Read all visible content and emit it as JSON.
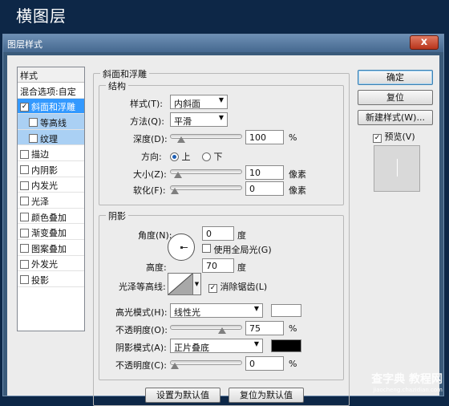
{
  "page_heading": "横图层",
  "window": {
    "title": "图层样式",
    "close_glyph": "x"
  },
  "styles_panel": {
    "header": "样式",
    "blend_options": "混合选项:自定",
    "items": [
      {
        "label": "斜面和浮雕",
        "checked": true,
        "selected": true,
        "sub": false
      },
      {
        "label": "等高线",
        "checked": false,
        "selected": false,
        "sub": true
      },
      {
        "label": "纹理",
        "checked": false,
        "selected": false,
        "sub": true
      },
      {
        "label": "描边",
        "checked": false,
        "selected": false,
        "sub": false
      },
      {
        "label": "内阴影",
        "checked": false,
        "selected": false,
        "sub": false
      },
      {
        "label": "内发光",
        "checked": false,
        "selected": false,
        "sub": false
      },
      {
        "label": "光泽",
        "checked": false,
        "selected": false,
        "sub": false
      },
      {
        "label": "颜色叠加",
        "checked": false,
        "selected": false,
        "sub": false
      },
      {
        "label": "渐变叠加",
        "checked": false,
        "selected": false,
        "sub": false
      },
      {
        "label": "图案叠加",
        "checked": false,
        "selected": false,
        "sub": false
      },
      {
        "label": "外发光",
        "checked": false,
        "selected": false,
        "sub": false
      },
      {
        "label": "投影",
        "checked": false,
        "selected": false,
        "sub": false
      }
    ]
  },
  "bevel": {
    "group_title": "斜面和浮雕",
    "structure": {
      "title": "结构",
      "style_label": "样式(T):",
      "style_value": "内斜面",
      "technique_label": "方法(Q):",
      "technique_value": "平滑",
      "depth_label": "深度(D):",
      "depth_value": "100",
      "depth_unit": "%",
      "depth_fraction": 0.1,
      "direction_label": "方向:",
      "direction_up": "上",
      "direction_down": "下",
      "direction_selected": "上",
      "size_label": "大小(Z):",
      "size_value": "10",
      "size_unit": "像素",
      "size_fraction": 0.05,
      "soften_label": "软化(F):",
      "soften_value": "0",
      "soften_unit": "像素",
      "soften_fraction": 0.0
    },
    "shading": {
      "title": "阴影",
      "angle_label": "角度(N):",
      "angle_value": "0",
      "angle_unit": "度",
      "global_light_label": "使用全局光(G)",
      "global_light_checked": false,
      "altitude_label": "高度:",
      "altitude_value": "70",
      "altitude_unit": "度",
      "gloss_contour_label": "光泽等高线:",
      "anti_alias_label": "消除锯齿(L)",
      "anti_alias_checked": true,
      "highlight_mode_label": "高光模式(H):",
      "highlight_mode_value": "线性光",
      "highlight_color": "#ffffff",
      "highlight_opacity_label": "不透明度(O):",
      "highlight_opacity_value": "75",
      "highlight_opacity_unit": "%",
      "highlight_opacity_fraction": 0.75,
      "shadow_mode_label": "阴影模式(A):",
      "shadow_mode_value": "正片叠底",
      "shadow_color": "#000000",
      "shadow_opacity_label": "不透明度(C):",
      "shadow_opacity_value": "0",
      "shadow_opacity_unit": "%",
      "shadow_opacity_fraction": 0.0
    },
    "make_default": "设置为默认值",
    "reset_default": "复位为默认值"
  },
  "actions": {
    "ok": "确定",
    "reset": "复位",
    "new_style": "新建样式(W)...",
    "preview_label": "预览(V)",
    "preview_checked": true
  },
  "watermark": {
    "main": "查字典 教程网",
    "sub": "jiaocheng.chazidian.com"
  },
  "colors": {
    "accent": "#3399ff",
    "sub_item": "#aad0f4",
    "titlebar": "#45688f"
  }
}
